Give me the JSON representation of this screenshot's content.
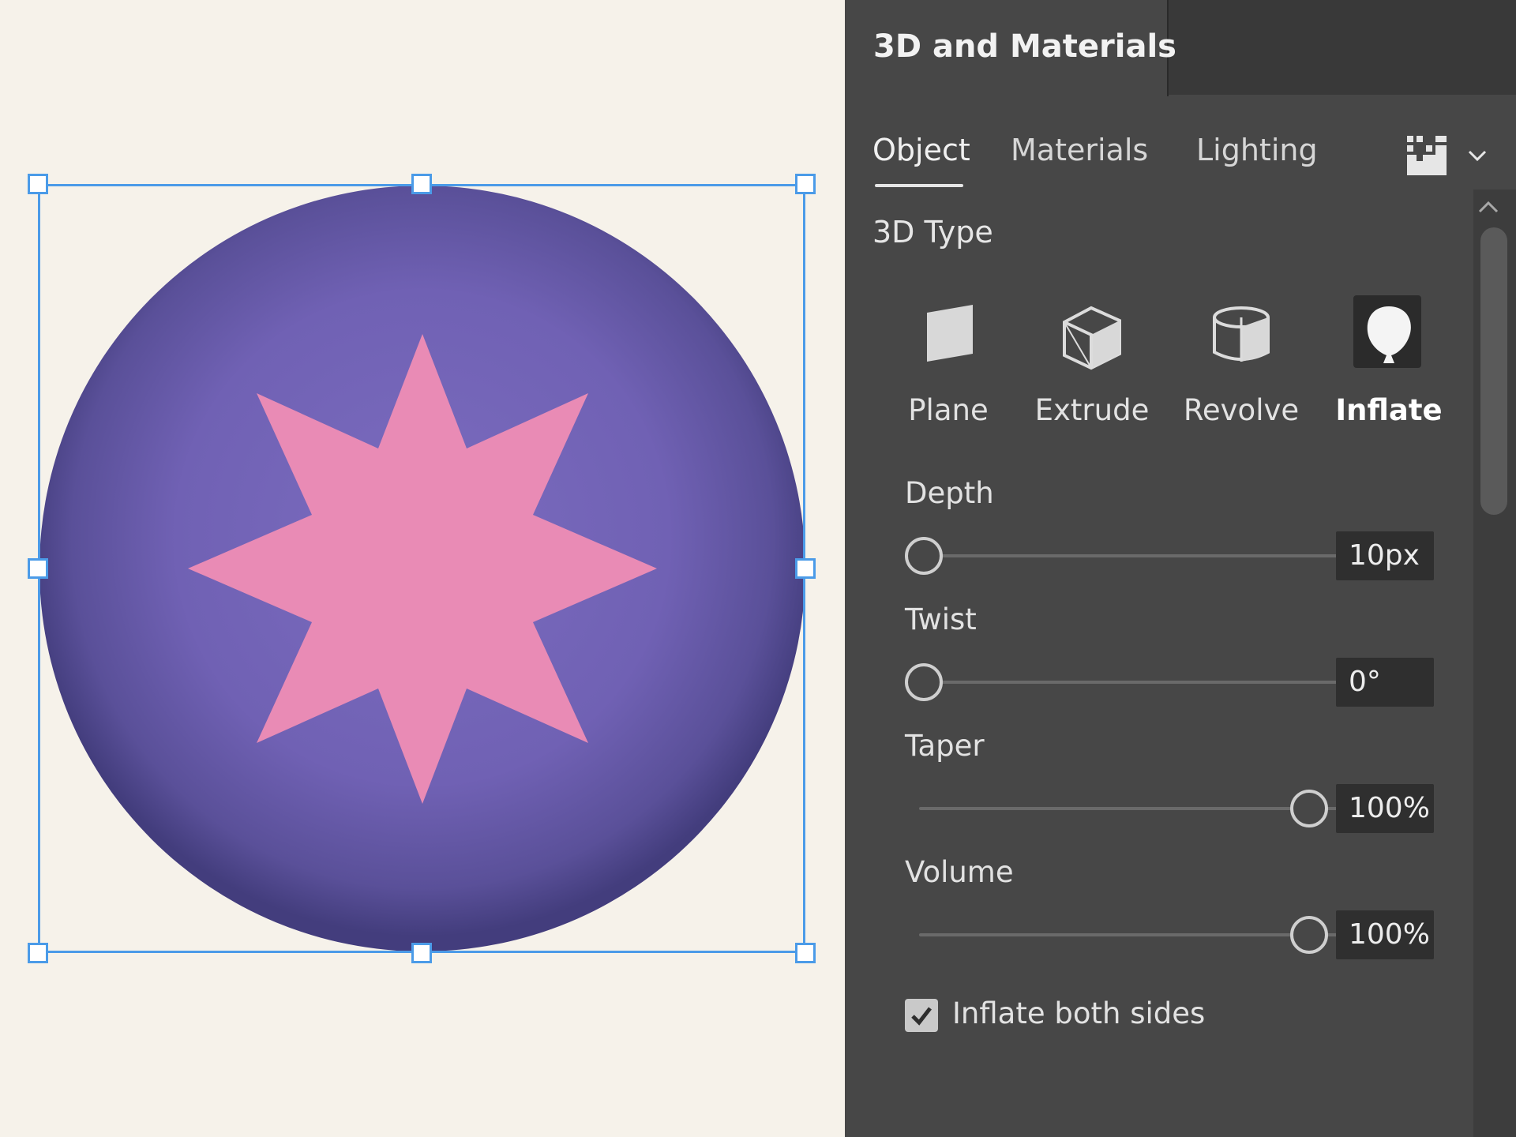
{
  "panel": {
    "title": "3D and Materials",
    "tabs": [
      {
        "label": "Object",
        "active": true
      },
      {
        "label": "Materials",
        "active": false
      },
      {
        "label": "Lighting",
        "active": false
      }
    ],
    "menu_icons": [
      "render-settings-icon",
      "chevron-down-icon"
    ]
  },
  "type_section": {
    "title": "3D Type",
    "types": [
      {
        "label": "Plane",
        "icon": "plane-icon",
        "active": false
      },
      {
        "label": "Extrude",
        "icon": "extrude-cube-icon",
        "active": false
      },
      {
        "label": "Revolve",
        "icon": "revolve-icon",
        "active": false
      },
      {
        "label": "Inflate",
        "icon": "inflate-balloon-icon",
        "active": true
      }
    ]
  },
  "properties": {
    "depth": {
      "label": "Depth",
      "value": "10px",
      "fraction": 0.0
    },
    "twist": {
      "label": "Twist",
      "value": "0°",
      "fraction": 0.0
    },
    "taper": {
      "label": "Taper",
      "value": "100%",
      "fraction": 1.0
    },
    "volume": {
      "label": "Volume",
      "value": "100%",
      "fraction": 1.0
    }
  },
  "options": {
    "inflate_both_sides": {
      "label": "Inflate both sides",
      "checked": true
    }
  },
  "colors": {
    "canvas_bg": "#f6f2ea",
    "selection": "#4b9be8",
    "sphere_center": "#7b6cbf",
    "sphere_edge": "#453f80",
    "star": "#e98bb5",
    "panel_bg": "#474747"
  }
}
